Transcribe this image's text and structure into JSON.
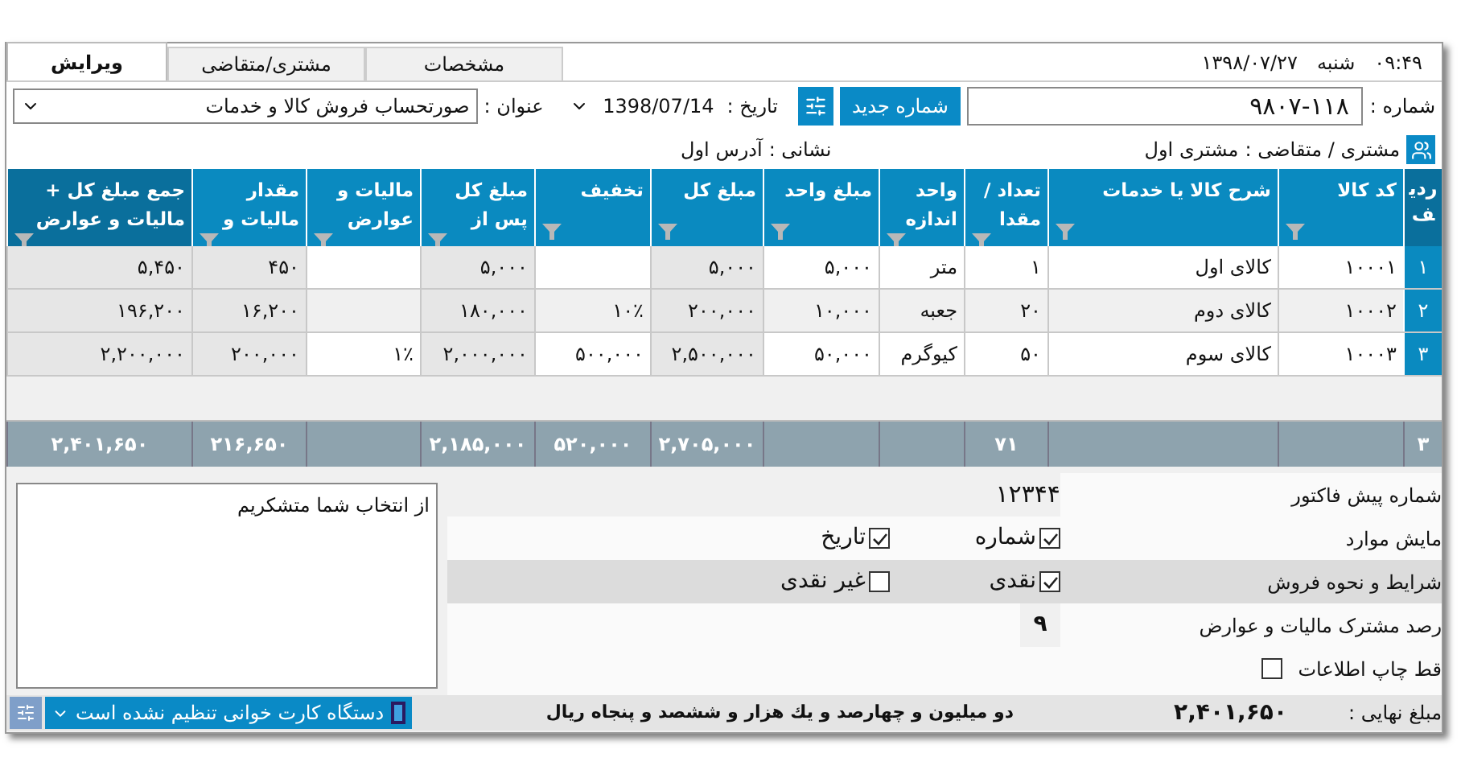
{
  "tabs": [
    {
      "label": "مشخصات",
      "selected": false
    },
    {
      "label": "مشتری/متقاضی",
      "selected": false
    },
    {
      "label": "ویرایش",
      "selected": true
    }
  ],
  "clock": {
    "time": "۰۹:۴۹",
    "weekday": "شنبه",
    "date": "۱۳۹۸/۰۷/۲۷"
  },
  "header": {
    "number_label": "شماره :",
    "number": "۹۸۰۷-۱۱۸",
    "new_number_button": "شماره جدید",
    "date_label": "تاریخ :",
    "date": "1398/07/14",
    "title_label": "عنوان :",
    "title": "صورتحساب فروش کالا و خدمات",
    "customer_label": "مشتری / متقاضی :",
    "customer": "مشتری اول",
    "address_label": "نشانی :",
    "address": "آدرس اول"
  },
  "table": {
    "row_header": "ردیف",
    "columns": [
      {
        "label": "کد کالا",
        "selected": false,
        "read_only": false
      },
      {
        "label": "شرح کالا یا خدمات",
        "selected": false,
        "read_only": false
      },
      {
        "label": "تعداد /مقدا",
        "selected": false,
        "read_only": false
      },
      {
        "label": "واحد اندازه",
        "selected": false,
        "read_only": false
      },
      {
        "label": "مبلغ واحد",
        "selected": false,
        "read_only": false
      },
      {
        "label": "مبلغ کل",
        "selected": false,
        "read_only": true
      },
      {
        "label": "تخفیف",
        "selected": false,
        "read_only": false
      },
      {
        "label": "مبلغ کل پس از",
        "selected": false,
        "read_only": true
      },
      {
        "label": "مالیات و عوارض",
        "selected": false,
        "read_only": false
      },
      {
        "label": "مقدار مالیات و",
        "selected": false,
        "read_only": true
      },
      {
        "label": "جمع مبلغ کل + مالیات و عوارض",
        "selected": true,
        "read_only": true
      }
    ],
    "rows": [
      {
        "number": "۱",
        "cells": [
          "۱۰۰۰۱",
          "کالای اول",
          "۱",
          "متر",
          "۵,۰۰۰",
          "۵,۰۰۰",
          null,
          "۵,۰۰۰",
          null,
          "۴۵۰",
          "۵,۴۵۰"
        ]
      },
      {
        "number": "۲",
        "cells": [
          "۱۰۰۰۲",
          "کالای دوم",
          "۲۰",
          "جعبه",
          "۱۰,۰۰۰",
          "۲۰۰,۰۰۰",
          "۱۰٪",
          "۱۸۰,۰۰۰",
          null,
          "۱۶,۲۰۰",
          "۱۹۶,۲۰۰"
        ]
      },
      {
        "number": "۳",
        "cells": [
          "۱۰۰۰۳",
          "کالای سوم",
          "۵۰",
          "کیوگرم",
          "۵۰,۰۰۰",
          "۲,۵۰۰,۰۰۰",
          "۵۰۰,۰۰۰",
          "۲,۰۰۰,۰۰۰",
          "۱٪",
          "۲۰۰,۰۰۰",
          "۲,۲۰۰,۰۰۰"
        ]
      }
    ],
    "totals": {
      "number": "۳",
      "cells": [
        null,
        null,
        "۷۱",
        null,
        null,
        "۲,۷۰۵,۰۰۰",
        "۵۲۰,۰۰۰",
        "۲,۱۸۵,۰۰۰",
        null,
        "۲۱۶,۶۵۰",
        "۲,۴۰۱,۶۵۰"
      ]
    }
  },
  "note": "از انتخاب شما متشکریم",
  "form": [
    {
      "kind": "value",
      "label": "شماره پیش فاکتور",
      "value": "۱۲۳۴۴"
    },
    {
      "kind": "checks",
      "label": "مایش موارد",
      "options": [
        {
          "label": "شماره",
          "checked": true
        },
        {
          "label": "تاریخ",
          "checked": true
        }
      ]
    },
    {
      "kind": "checks",
      "label": "شرایط و نحوه فروش",
      "options": [
        {
          "label": "نقدی",
          "checked": true
        },
        {
          "label": "غیر نقدی",
          "checked": false
        }
      ]
    },
    {
      "kind": "number",
      "label": "رصد مشترک مالیات و عوارض",
      "value": "۹"
    },
    {
      "kind": "check",
      "label": "قط چاپ اطلاعات",
      "checked": false
    }
  ],
  "footer": {
    "total_label": "مبلغ نهایی :",
    "total": "۲,۴۰۱,۶۵۰",
    "words": "دو میلیون و چهارصد و  یك هزار و ششصد و پنجاه ریال",
    "card_reader": "دستگاه کارت خوانی تنظیم نشده است"
  }
}
